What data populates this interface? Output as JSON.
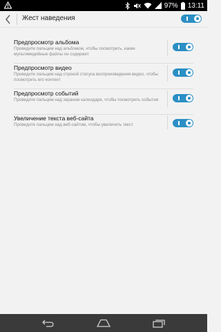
{
  "status_bar": {
    "battery_percent": "97%",
    "time": "13:11",
    "icons": [
      "warning-icon",
      "bluetooth-icon",
      "mute-icon",
      "wifi-icon",
      "signal-icon",
      "battery-icon"
    ]
  },
  "header": {
    "title": "Жест наведения",
    "master_toggle_on": true
  },
  "items": [
    {
      "title": "Предпросмотр альбома",
      "description": "Проведите пальцем над альбомом, чтобы посмотреть, какие мультимедийные файлы он содержит",
      "enabled": true
    },
    {
      "title": "Предпросмотр видео",
      "description": "Проведите пальцем над строкой статуса воспроизведения видео, чтобы посмотреть его контент",
      "enabled": true
    },
    {
      "title": "Предпросмотр событий",
      "description": "Проведите пальцем над экраном календаря, чтобы посмотреть события",
      "enabled": true
    },
    {
      "title": "Увеличение текста веб-сайта",
      "description": "Проведите пальцем над веб-сайтом, чтобы увеличить текст",
      "enabled": true
    }
  ],
  "nav_bar": {
    "buttons": [
      "back-icon",
      "home-icon",
      "recents-icon"
    ]
  },
  "colors": {
    "accent": "#2b8fc4",
    "background": "#f2f2f2",
    "status_bar": "#000000",
    "nav_bar": "#3a3a3a"
  }
}
